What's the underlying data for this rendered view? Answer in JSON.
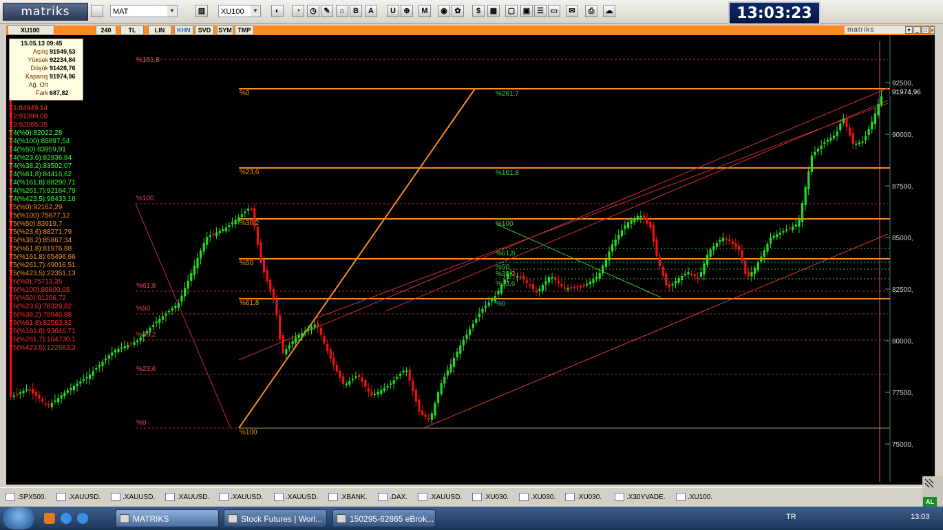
{
  "toolbar": {
    "logo": "matriks",
    "symbol_combo": "MAT",
    "index_combo": "XU100",
    "clock": "13:03:23",
    "icons": [
      "save-icon",
      "bar-chart-icon",
      "pie-chart-icon",
      "gauge-icon",
      "clock-icon",
      "paint-icon",
      "house-icon",
      "b-icon",
      "a-icon",
      "u-icon",
      "network-icon",
      "m-icon",
      "eye-icon",
      "flower-icon",
      "stock-icon",
      "table-icon",
      "window-icon",
      "briefcase-icon",
      "news-icon",
      "monitor-icon",
      "mail-icon",
      "printer-icon",
      "cloud-icon"
    ]
  },
  "chart_toolbar": {
    "symbol": "XU100",
    "tabs": [
      "240",
      "TL",
      "LIN",
      "KHN",
      "SVD",
      "SYM",
      "TMP"
    ],
    "brand": "matriks",
    "controls": [
      "▾",
      "_",
      "□",
      "x"
    ]
  },
  "infobox": {
    "date": "15.05.13 09:45",
    "rows": [
      {
        "k": "Açılış",
        "v": "91549,53"
      },
      {
        "k": "Yüksek",
        "v": "92234,84"
      },
      {
        "k": "Düşük",
        "v": "91428,76"
      },
      {
        "k": "Kapanış",
        "v": "91974,96"
      },
      {
        "k": "Ağ. Ort",
        "v": ""
      },
      {
        "k": "Fark",
        "v": "687,82"
      }
    ]
  },
  "levels": [
    {
      "t": "T1:84949,14",
      "c": "#ff3030"
    },
    {
      "t": "T2:91399,09",
      "c": "#ff3030"
    },
    {
      "t": "T3:92065,35",
      "c": "#ff3030"
    },
    {
      "t": "T4(%0):82022,28",
      "c": "#3dff3d"
    },
    {
      "t": "T4(%100):85897,54",
      "c": "#3dff3d"
    },
    {
      "t": "T4(%50):83959,91",
      "c": "#3dff3d"
    },
    {
      "t": "T4(%23,6):82936,84",
      "c": "#3dff3d"
    },
    {
      "t": "T4(%38,2):83502,07",
      "c": "#3dff3d"
    },
    {
      "t": "T4(%61,8):84416,62",
      "c": "#3dff3d"
    },
    {
      "t": "T4(%161,8):88290,71",
      "c": "#3dff3d"
    },
    {
      "t": "T4(%261,7):92164,79",
      "c": "#3dff3d"
    },
    {
      "t": "T4(%423,5):98433,16",
      "c": "#3dff3d"
    },
    {
      "t": "T5(%0):92162,29",
      "c": "#ff9030"
    },
    {
      "t": "T5(%100):75677,12",
      "c": "#ff9030"
    },
    {
      "t": "T5(%50):83919,7",
      "c": "#ff9030"
    },
    {
      "t": "T5(%23,6):88271,79",
      "c": "#ff9030"
    },
    {
      "t": "T5(%38,2):85867,34",
      "c": "#ff9030"
    },
    {
      "t": "T5(%61,8):81976,88",
      "c": "#ff9030"
    },
    {
      "t": "T5(%161,8):65496,66",
      "c": "#ff9030"
    },
    {
      "t": "T5(%261,7):49016,51",
      "c": "#ff9030"
    },
    {
      "t": "T5(%423,5):22351,13",
      "c": "#ff9030"
    },
    {
      "t": "T6(%0):75713,35",
      "c": "#ff3030"
    },
    {
      "t": "T6(%100):86800,08",
      "c": "#ff3030"
    },
    {
      "t": "T6(%50):81256,72",
      "c": "#ff3030"
    },
    {
      "t": "T6(%23,6):78329,82",
      "c": "#ff3030"
    },
    {
      "t": "T6(%38,2):79946,88",
      "c": "#ff3030"
    },
    {
      "t": "T6(%61,8):82563,32",
      "c": "#ff3030"
    },
    {
      "t": "T6(%161,8):93646,71",
      "c": "#ff3030"
    },
    {
      "t": "T6(%261,7):104730,1",
      "c": "#ff3030"
    },
    {
      "t": "T6(%423,5):122663,3",
      "c": "#ff3030"
    }
  ],
  "chart_data": {
    "type": "candlestick",
    "ylim": [
      74000,
      94000
    ],
    "y_ticks": [
      "92500,",
      "90000,",
      "87500,",
      "85000,",
      "82500,",
      "80000,",
      "77500,",
      "75000,"
    ],
    "last_price": "91974,96",
    "fib_labels_red": [
      "%161,8",
      "%100",
      "%61,8",
      "%50",
      "%38,2",
      "%23,6",
      "%0"
    ],
    "fib_labels_orange": [
      "%0",
      "%23,6",
      "%38,2",
      "%50",
      "%61,8",
      "%100"
    ],
    "fib_labels_green": [
      "%261,7",
      "%161,8",
      "%100",
      "%61,8",
      "%50",
      "%38,2",
      "%23,6",
      "%0"
    ],
    "colors": {
      "up": "#22dd22",
      "down": "#ee1111",
      "orange": "#ff8c1a",
      "red": "#c8283c",
      "green": "#3dcf3d",
      "axis": "#cfcfcf"
    }
  },
  "sheet_tabs": [
    ".SPX500.",
    ".XAUUSD.",
    ".XAUUSD.",
    ".XAUUSD.",
    ".XAUUSD.",
    ".XAUUSD.",
    ".XBANK.",
    ".DAX.",
    ".XAUUSD.",
    ".XU030.",
    ".XU030.",
    ".XU030.",
    ".X30YVADE.",
    ".XU100."
  ],
  "corner_badge": "AL",
  "taskbar": {
    "tasks": [
      "MATRIKS",
      "Stock Futures | Worl...",
      "150295-62865 eBrok..."
    ],
    "lang": "TR",
    "time": "13:03"
  }
}
